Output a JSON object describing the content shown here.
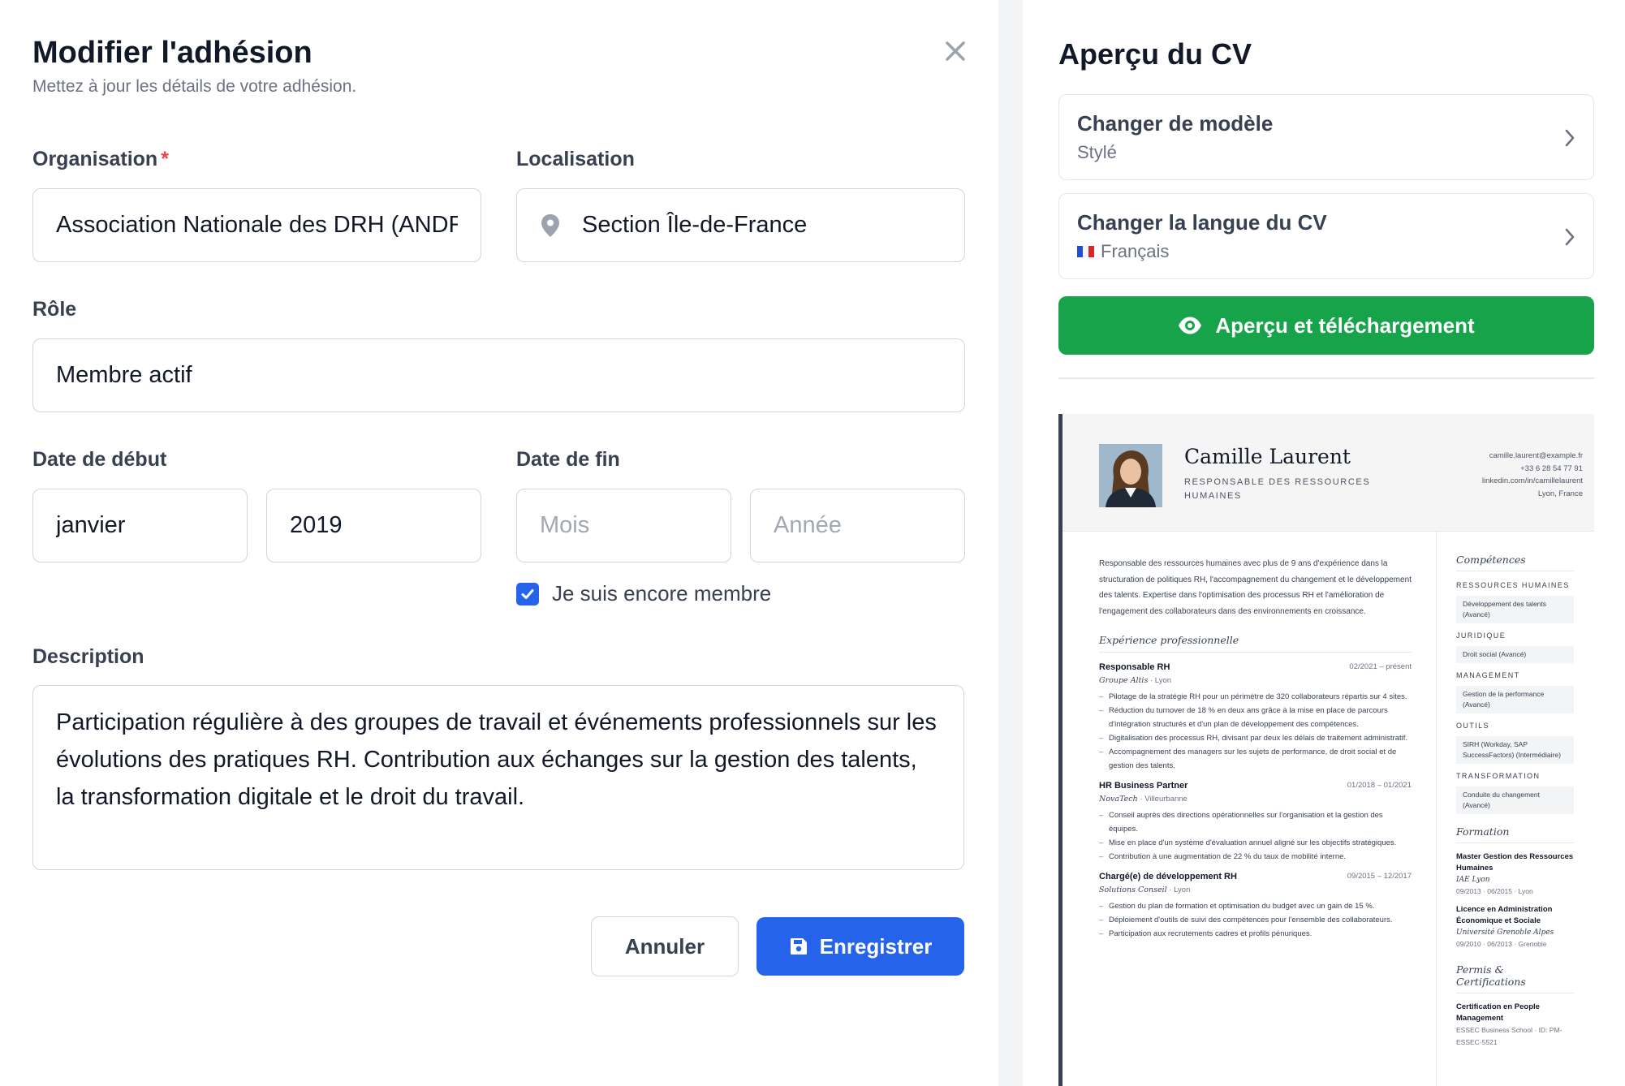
{
  "modal": {
    "title": "Modifier l'adhésion",
    "subtitle": "Mettez à jour les détails de votre adhésion."
  },
  "form": {
    "organisation_label": "Organisation",
    "required_mark": "*",
    "organisation_value": "Association Nationale des DRH (ANDRH)",
    "location_label": "Localisation",
    "location_value": "Section Île-de-France",
    "role_label": "Rôle",
    "role_value": "Membre actif",
    "start_label": "Date de début",
    "start_month": "janvier",
    "start_year": "2019",
    "end_label": "Date de fin",
    "end_month_placeholder": "Mois",
    "end_year_placeholder": "Année",
    "still_member_label": "Je suis encore membre",
    "still_member_checked": true,
    "description_label": "Description",
    "description_value": "Participation régulière à des groupes de travail et événements professionnels sur les évolutions des pratiques RH. Contribution aux échanges sur la gestion des talents, la transformation digitale et le droit du travail.",
    "cancel_label": "Annuler",
    "save_label": "Enregistrer"
  },
  "preview": {
    "title": "Aperçu du CV",
    "template_title": "Changer de modèle",
    "template_value": "Stylé",
    "language_title": "Changer la langue du CV",
    "language_value": "Français",
    "preview_button": "Aperçu et téléchargement"
  },
  "cv": {
    "name": "Camille Laurent",
    "job_title": "RESPONSABLE DES RESSOURCES HUMAINES",
    "contact": [
      "camille.laurent@example.fr",
      "+33 6 28 54 77 91",
      "linkedin.com/in/camillelaurent",
      "Lyon, France"
    ],
    "summary": "Responsable des ressources humaines avec plus de 9 ans d'expérience dans la structuration de politiques RH, l'accompagnement du changement et le développement des talents. Expertise dans l'optimisation des processus RH et l'amélioration de l'engagement des collaborateurs dans des environnements en croissance.",
    "experience_title": "Expérience professionnelle",
    "jobs": [
      {
        "title": "Responsable RH",
        "dates": "02/2021 – présent",
        "company": "Groupe Altis",
        "city": "Lyon",
        "bullets": [
          "Pilotage de la stratégie RH pour un périmètre de 320 collaborateurs répartis sur 4 sites.",
          "Réduction du turnover de 18 % en deux ans grâce à la mise en place de parcours d'intégration structurés et d'un plan de développement des compétences.",
          "Digitalisation des processus RH, divisant par deux les délais de traitement administratif.",
          "Accompagnement des managers sur les sujets de performance, de droit social et de gestion des talents."
        ]
      },
      {
        "title": "HR Business Partner",
        "dates": "01/2018 – 01/2021",
        "company": "NovaTech",
        "city": "Villeurbanne",
        "bullets": [
          "Conseil auprès des directions opérationnelles sur l'organisation et la gestion des équipes.",
          "Mise en place d'un système d'évaluation annuel aligné sur les objectifs stratégiques.",
          "Contribution à une augmentation de 22 % du taux de mobilité interne."
        ]
      },
      {
        "title": "Chargé(e) de développement RH",
        "dates": "09/2015 – 12/2017",
        "company": "Solutions Conseil",
        "city": "Lyon",
        "bullets": [
          "Gestion du plan de formation et optimisation du budget avec un gain de 15 %.",
          "Déploiement d'outils de suivi des compétences pour l'ensemble des collaborateurs.",
          "Participation aux recrutements cadres et profils pénuriques."
        ]
      }
    ],
    "skills_title": "Compétences",
    "skills": [
      {
        "category": "RESSOURCES HUMAINES",
        "item": "Développement des talents (Avancé)"
      },
      {
        "category": "JURIDIQUE",
        "item": "Droit social (Avancé)"
      },
      {
        "category": "MANAGEMENT",
        "item": "Gestion de la performance (Avancé)"
      },
      {
        "category": "OUTILS",
        "item": "SIRH (Workday, SAP SuccessFactors) (Intermédiaire)"
      },
      {
        "category": "TRANSFORMATION",
        "item": "Conduite du changement (Avancé)"
      }
    ],
    "education_title": "Formation",
    "education": [
      {
        "title": "Master Gestion des Ressources Humaines",
        "school": "IAE Lyon",
        "dates": "09/2013 · 06/2015 · Lyon"
      },
      {
        "title": "Licence en Administration Économique et Sociale",
        "school": "Université Grenoble Alpes",
        "dates": "09/2010 · 06/2013 · Grenoble"
      }
    ],
    "certs_title": "Permis & Certifications",
    "certs": [
      {
        "title": "Certification en People Management",
        "detail": "ESSEC Business School · ID: PM-ESSEC-5521"
      }
    ]
  },
  "colors": {
    "primary": "#2563eb",
    "success": "#16a34a",
    "required": "#ef4444",
    "cv_accent": "#374151"
  },
  "icons": [
    "close-icon",
    "map-pin-icon",
    "checkmark-icon",
    "save-icon",
    "chevron-right-icon",
    "eye-icon",
    "french-flag-icon"
  ]
}
